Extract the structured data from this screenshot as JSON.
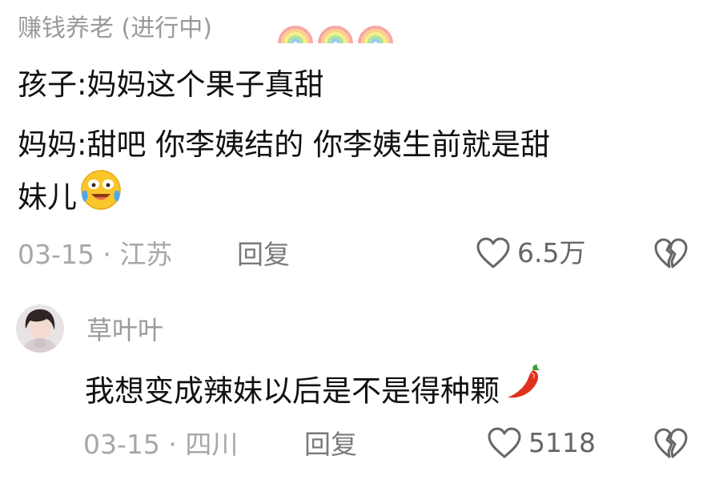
{
  "top_comment": {
    "username": "赚钱养老 (进行中)",
    "username_emojis": [
      "rainbow-icon",
      "rainbow-icon",
      "rainbow-icon"
    ],
    "lines": [
      "孩子:妈妈这个果子真甜",
      "妈妈:甜吧  你李姨结的 你李姨生前就是甜",
      "妹儿"
    ],
    "trailing_emoji": "crying-laughing-face-icon",
    "date": "03-15",
    "separator": "·",
    "location": "江苏",
    "reply_label": "回复",
    "like_count": "6.5万"
  },
  "reply_comment": {
    "username": "草叶叶",
    "text": "我想变成辣妹以后是不是得种颗",
    "trailing_emoji": "chili-pepper-icon",
    "date": "03-15",
    "separator": "·",
    "location": "四川",
    "reply_label": "回复",
    "like_count": "5118"
  },
  "colors": {
    "text_primary": "#111111",
    "text_secondary": "#9a9a9a",
    "icon_gray": "#666666"
  }
}
